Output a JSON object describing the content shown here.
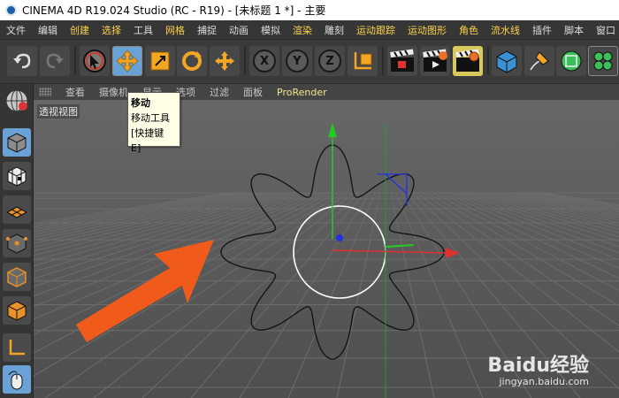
{
  "window": {
    "title": "CINEMA 4D R19.024 Studio (RC - R19) - [未标题 1 *] - 主要"
  },
  "menu": {
    "items": [
      "文件",
      "编辑",
      "创建",
      "选择",
      "工具",
      "网格",
      "捕捉",
      "动画",
      "模拟",
      "渲染",
      "雕刻",
      "运动跟踪",
      "运动图形",
      "角色",
      "流水线",
      "插件",
      "脚本",
      "窗口"
    ],
    "highlighted": [
      "创建",
      "选择",
      "网格",
      "渲染",
      "运动跟踪",
      "运动图形",
      "角色",
      "流水线"
    ]
  },
  "toolbar": {
    "undo_icon": "undo-icon",
    "redo_icon": "redo-icon",
    "axis_x_label": "X",
    "axis_y_label": "Y",
    "axis_z_label": "Z"
  },
  "viewport_menu": {
    "items": [
      "查看",
      "摄像机",
      "显示",
      "选项",
      "过滤",
      "面板"
    ],
    "prorender": "ProRender"
  },
  "viewport": {
    "label": "透视视图"
  },
  "tooltip": {
    "title": "移动",
    "name": "移动工具",
    "shortcut": "[快捷键 E]"
  },
  "watermark": {
    "logo": "Baidu经验",
    "site": "jingyan.baidu.com"
  },
  "colors": {
    "accent_blue": "#6aa2d8",
    "arrow_orange": "#f05a1a",
    "axis_green": "#22cc22",
    "axis_red": "#e03030",
    "axis_blue": "#2233dd"
  }
}
